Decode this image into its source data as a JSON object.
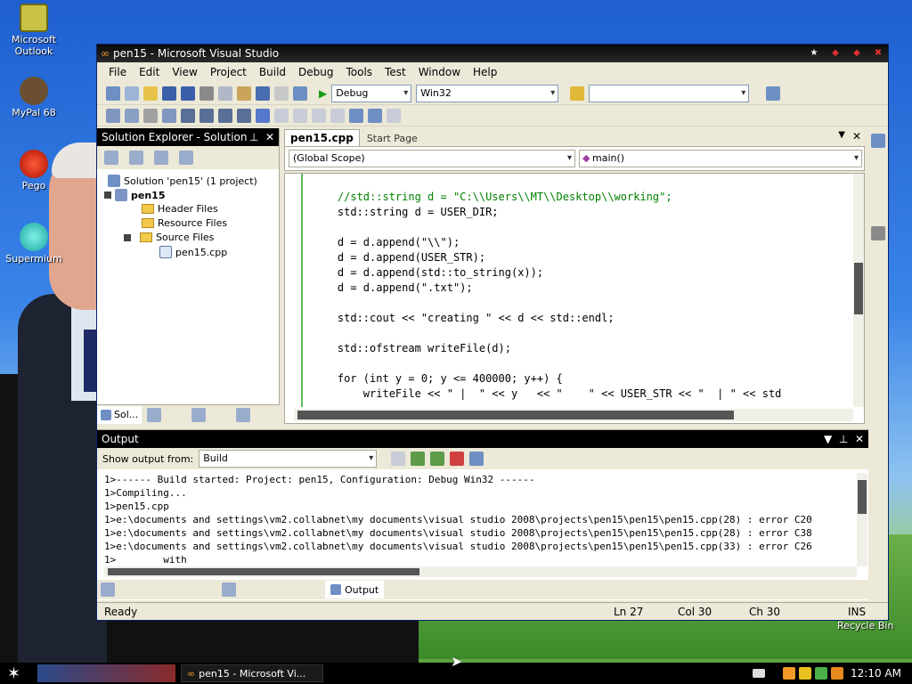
{
  "desktop": {
    "icons": [
      {
        "label": "Microsoft Outlook"
      },
      {
        "label": "MyPal 68"
      },
      {
        "label": "Pego"
      },
      {
        "label": "Supermium"
      }
    ],
    "recycle_bin": "Recycle Bin"
  },
  "window": {
    "title": "pen15 - Microsoft Visual Studio",
    "menu": [
      "File",
      "Edit",
      "View",
      "Project",
      "Build",
      "Debug",
      "Tools",
      "Test",
      "Window",
      "Help"
    ],
    "toolbar": {
      "config": "Debug",
      "platform": "Win32"
    }
  },
  "solution_explorer": {
    "title": "Solution Explorer - Solution '...",
    "tree": {
      "solution": "Solution 'pen15' (1 project)",
      "project": "pen15",
      "header_files": "Header Files",
      "resource_files": "Resource Files",
      "source_files": "Source Files",
      "file": "pen15.cpp"
    },
    "bottom_tab": "Sol..."
  },
  "editor": {
    "tabs": [
      "pen15.cpp",
      "Start Page"
    ],
    "scope": "(Global Scope)",
    "member": "main()",
    "lines": [
      "    //std::string d = \"C:\\\\Users\\\\MT\\\\Desktop\\\\working\";",
      "    std::string d = USER_DIR;",
      "",
      "    d = d.append(\"\\\\\");",
      "    d = d.append(USER_STR);",
      "    d = d.append(std::to_string(x));",
      "    d = d.append(\".txt\");",
      "",
      "    std::cout << \"creating \" << d << std::endl;",
      "",
      "    std::ofstream writeFile(d);",
      "",
      "    for (int y = 0; y <= 400000; y++) {",
      "        writeFile << \" |  \" << y   << \"    \" << USER_STR << \"  | \" << std"
    ]
  },
  "output": {
    "title": "Output",
    "show_from_label": "Show output from:",
    "show_from_value": "Build",
    "lines": [
      "1>------ Build started: Project: pen15, Configuration: Debug Win32 ------",
      "1>Compiling...",
      "1>pen15.cpp",
      "1>e:\\documents and settings\\vm2.collabnet\\my documents\\visual studio 2008\\projects\\pen15\\pen15\\pen15.cpp(28) : error C20",
      "1>e:\\documents and settings\\vm2.collabnet\\my documents\\visual studio 2008\\projects\\pen15\\pen15\\pen15.cpp(28) : error C38",
      "1>e:\\documents and settings\\vm2.collabnet\\my documents\\visual studio 2008\\projects\\pen15\\pen15\\pen15.cpp(33) : error C26",
      "1>        with"
    ],
    "tab": "Output"
  },
  "status": {
    "ready": "Ready",
    "ln": "Ln 27",
    "col": "Col 30",
    "ch": "Ch 30",
    "ins": "INS"
  },
  "taskbar": {
    "items": [
      "pen15 - Microsoft Vi..."
    ],
    "clock": "12:10 AM"
  }
}
